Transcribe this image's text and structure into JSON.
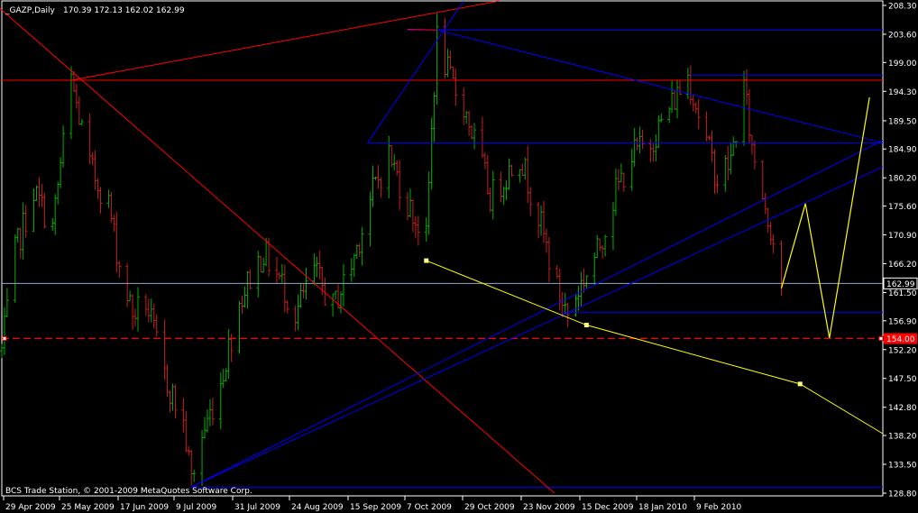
{
  "header": {
    "symbol": "_GAZP,Daily",
    "ohlc": "170.39 172.13 162.02 162.99"
  },
  "footer_text": "BCS Trade Station, © 2001-2009 MetaQuotes Software Corp.",
  "colors": {
    "background": "#000000",
    "frame": "#ffffff",
    "bull": "#00b000",
    "bear": "#c81e1e",
    "blue_line": "#0000ff",
    "red_line": "#ff0000",
    "yellow_line": "#ffff00",
    "current_price_line": "#8ea8c8"
  },
  "chart_data": {
    "type": "candlestick-bar",
    "symbol": "_GAZP",
    "timeframe": "Daily",
    "last": {
      "open": 170.39,
      "high": 172.13,
      "low": 162.02,
      "close": 162.99
    },
    "x_tick_labels": [
      "29 Apr 2009",
      "25 May 2009",
      "17 Jun 2009",
      "9 Jul 2009",
      "31 Jul 2009",
      "24 Aug 2009",
      "15 Sep 2009",
      "7 Oct 2009",
      "29 Oct 2009",
      "23 Nov 2009",
      "15 Dec 2009",
      "18 Jan 2010",
      "9 Feb 2010"
    ],
    "x_range": [
      "2009-04-29",
      "2010-03-25"
    ],
    "y_tick_labels": [
      "208.30",
      "203.60",
      "199.00",
      "194.30",
      "189.50",
      "184.90",
      "180.20",
      "175.60",
      "170.90",
      "166.20",
      "161.50",
      "156.90",
      "152.20",
      "147.50",
      "142.80",
      "138.20",
      "133.50",
      "128.80"
    ],
    "ylim": [
      128.8,
      208.3
    ],
    "current_price_label": "162.99",
    "level_label": "154.00",
    "grid": false,
    "price_points": [
      [
        "2009-04-29",
        152
      ],
      [
        "2009-05-04",
        168
      ],
      [
        "2009-05-11",
        178
      ],
      [
        "2009-05-18",
        172
      ],
      [
        "2009-05-25",
        196
      ],
      [
        "2009-06-01",
        182
      ],
      [
        "2009-06-08",
        176
      ],
      [
        "2009-06-12",
        166
      ],
      [
        "2009-06-17",
        158
      ],
      [
        "2009-06-22",
        160
      ],
      [
        "2009-06-29",
        148
      ],
      [
        "2009-07-06",
        140
      ],
      [
        "2009-07-09",
        131
      ],
      [
        "2009-07-13",
        138
      ],
      [
        "2009-07-20",
        147
      ],
      [
        "2009-07-27",
        160
      ],
      [
        "2009-07-31",
        164
      ],
      [
        "2009-08-05",
        168
      ],
      [
        "2009-08-12",
        163
      ],
      [
        "2009-08-17",
        158
      ],
      [
        "2009-08-24",
        165
      ],
      [
        "2009-08-31",
        159
      ],
      [
        "2009-09-07",
        166
      ],
      [
        "2009-09-15",
        178
      ],
      [
        "2009-09-21",
        184
      ],
      [
        "2009-09-28",
        176
      ],
      [
        "2009-10-05",
        170
      ],
      [
        "2009-10-07",
        188
      ],
      [
        "2009-10-09",
        203
      ],
      [
        "2009-10-14",
        196
      ],
      [
        "2009-10-19",
        192
      ],
      [
        "2009-10-26",
        182
      ],
      [
        "2009-10-29",
        177
      ],
      [
        "2009-11-03",
        180
      ],
      [
        "2009-11-09",
        184
      ],
      [
        "2009-11-16",
        174
      ],
      [
        "2009-11-23",
        162
      ],
      [
        "2009-11-27",
        158
      ],
      [
        "2009-12-02",
        163
      ],
      [
        "2009-12-08",
        168
      ],
      [
        "2009-12-15",
        178
      ],
      [
        "2009-12-21",
        184
      ],
      [
        "2009-12-28",
        186
      ],
      [
        "2010-01-11",
        197
      ],
      [
        "2010-01-18",
        186
      ],
      [
        "2010-01-22",
        180
      ],
      [
        "2010-01-27",
        183
      ],
      [
        "2010-02-01",
        195
      ],
      [
        "2010-02-04",
        185
      ],
      [
        "2010-02-09",
        176
      ],
      [
        "2010-02-12",
        170
      ],
      [
        "2010-02-15",
        163
      ]
    ],
    "horizontal_lines": [
      {
        "name": "red-level-196",
        "price": 196.1,
        "from": "2009-04-29",
        "to": "2010-03-25",
        "color": "red",
        "style": "solid"
      },
      {
        "name": "blue-level-204.3",
        "price": 204.3,
        "from": "2009-09-28",
        "to": "2010-03-25",
        "color": "blue",
        "style": "solid"
      },
      {
        "name": "blue-level-197",
        "price": 196.9,
        "from": "2010-01-12",
        "to": "2010-03-25",
        "color": "blue",
        "style": "solid"
      },
      {
        "name": "blue-level-186",
        "price": 185.9,
        "from": "2009-09-13",
        "to": "2010-03-25",
        "color": "blue",
        "style": "solid"
      },
      {
        "name": "blue-level-158",
        "price": 158.3,
        "from": "2009-11-25",
        "to": "2010-03-25",
        "color": "blue",
        "style": "solid"
      },
      {
        "name": "blue-level-130",
        "price": 129.8,
        "from": "2009-07-09",
        "to": "2010-03-25",
        "color": "blue",
        "style": "solid"
      },
      {
        "name": "current-price",
        "price": 162.99,
        "from": "2009-04-29",
        "to": "2010-03-25",
        "color": "slate",
        "style": "solid"
      },
      {
        "name": "red-dashed-154",
        "price": 154.0,
        "from": "2009-04-29",
        "to": "2010-03-25",
        "color": "red",
        "style": "dashed"
      }
    ],
    "trend_lines": [
      {
        "name": "red-diagonal-down",
        "color": "red",
        "from": [
          "2009-04-27",
          208.3
        ],
        "to": [
          "2009-11-22",
          128.8
        ]
      },
      {
        "name": "red-upper-trend",
        "color": "red",
        "from": [
          "2009-05-25",
          196.1
        ],
        "to": [
          "2009-11-01",
          209.0
        ]
      },
      {
        "name": "red-fan-line",
        "color": "red",
        "from": [
          "2009-09-28",
          204.4
        ],
        "to": [
          "2009-10-09",
          204.3
        ]
      },
      {
        "name": "blue-fan-up",
        "color": "blue",
        "from": [
          "2009-09-13",
          185.9
        ],
        "to": [
          "2009-10-19",
          209.0
        ]
      },
      {
        "name": "blue-top-down",
        "color": "blue",
        "from": [
          "2009-10-09",
          204.3
        ],
        "to": [
          "2010-03-25",
          185.9
        ]
      },
      {
        "name": "blue-rise-1",
        "color": "blue",
        "from": [
          "2009-07-09",
          129.8
        ],
        "to": [
          "2010-03-25",
          186.3
        ]
      },
      {
        "name": "blue-rise-2",
        "color": "blue",
        "from": [
          "2009-07-09",
          129.8
        ],
        "to": [
          "2010-03-25",
          182.0
        ]
      }
    ],
    "yellow_channel": {
      "points": [
        [
          "2009-10-05",
          166.7
        ],
        [
          "2009-12-04",
          156.2
        ],
        [
          "2010-02-22",
          146.6
        ],
        [
          "2010-03-25",
          138.5
        ]
      ],
      "markers": [
        [
          "2009-10-05",
          166.7
        ],
        [
          "2009-12-04",
          156.2
        ],
        [
          "2010-02-22",
          146.6
        ]
      ]
    },
    "yellow_projection": [
      [
        "2010-02-15",
        162.2
      ],
      [
        "2010-02-24",
        176.0
      ],
      [
        "2010-03-05",
        154.1
      ],
      [
        "2010-03-20",
        193.3
      ]
    ]
  }
}
